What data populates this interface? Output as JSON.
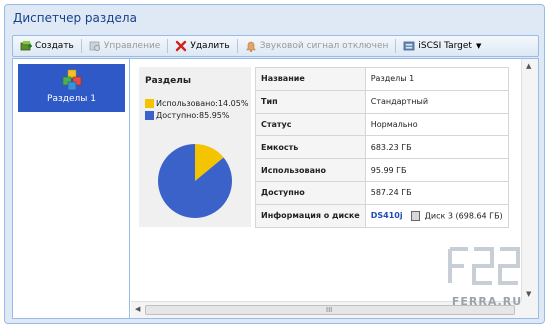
{
  "window": {
    "title": "Диспетчер раздела"
  },
  "toolbar": {
    "create_label": "Создать",
    "manage_label": "Управление",
    "delete_label": "Удалить",
    "beep_label": "Звуковой сигнал отключен",
    "iscsi_label": "iSCSI Target"
  },
  "sidebar": {
    "items": [
      {
        "label": "Разделы 1",
        "icon": "volume-cubes-icon",
        "selected": true
      }
    ]
  },
  "summary": {
    "title": "Разделы",
    "used_label": "Использовано:14.05%",
    "free_label": "Доступно:85.95%",
    "colors": {
      "used": "#f5c400",
      "free": "#3a62c9"
    }
  },
  "chart_data": {
    "type": "pie",
    "categories": [
      "Использовано",
      "Доступно"
    ],
    "values": [
      14.05,
      85.95
    ],
    "colors": [
      "#f5c400",
      "#3a62c9"
    ]
  },
  "properties": {
    "rows": [
      {
        "key": "Название",
        "value": "Разделы 1"
      },
      {
        "key": "Тип",
        "value": "Стандартный"
      },
      {
        "key": "Статус",
        "value": "Нормально"
      },
      {
        "key": "Емкость",
        "value": "683.23 ГБ"
      },
      {
        "key": "Использовано",
        "value": "95.99 ГБ"
      },
      {
        "key": "Доступно",
        "value": "587.24 ГБ"
      }
    ],
    "disk_info_key": "Информация о диске",
    "disk_link": "DS410j",
    "disk_value": "Диск 3 (698.64 ГБ)"
  },
  "scrollbar": {
    "grip": "III"
  },
  "watermark": {
    "text": "FERRA.RU"
  },
  "colors": {
    "accent": "#2f59c7",
    "title": "#15428b",
    "frame": "#99bbe8"
  }
}
